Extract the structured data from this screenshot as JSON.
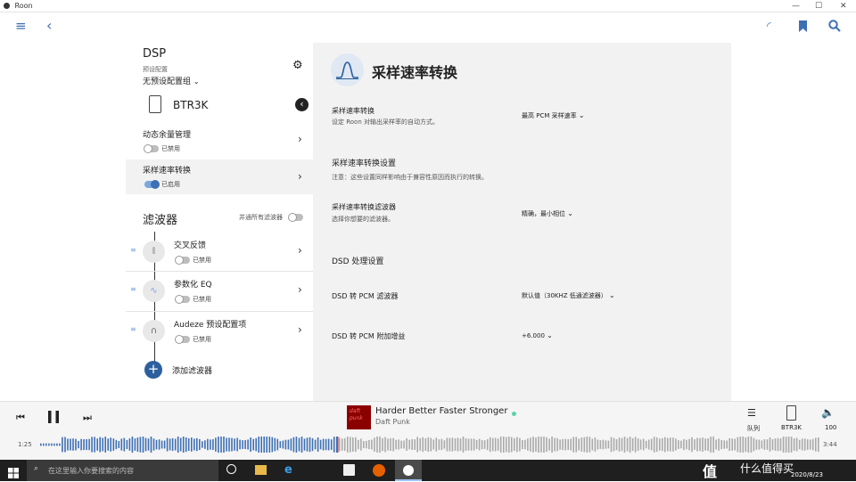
{
  "window": {
    "title": "Roon"
  },
  "left": {
    "dsp_title": "DSP",
    "preset_label": "预设配置",
    "preset_value": "无预设配置组",
    "device_name": "BTR3K",
    "headroom": {
      "label": "动态余量管理",
      "state": "已禁用"
    },
    "resample": {
      "label": "采样速率转换",
      "state": "已启用"
    },
    "filters_title": "滤波器",
    "bypass_label": "并通所有滤波器",
    "filters": [
      {
        "label": "交叉反馈",
        "state": "已禁用"
      },
      {
        "label": "参数化 EQ",
        "state": "已禁用"
      },
      {
        "label": "Audeze 预设配置项",
        "state": "已禁用"
      }
    ],
    "add_filter": "添加滤波器"
  },
  "right": {
    "title": "采样速率转换",
    "row1": {
      "label": "采样速率转换",
      "desc": "设定 Roon 对输出采样率的自动方式。",
      "value": "最高 PCM 采样速率"
    },
    "section2": "采样速率转换设置",
    "section2_note": "注意：这些设置同样影响由于兼容性原因而执行的转换。",
    "row2": {
      "label": "采样速率转换滤波器",
      "desc": "选择你想要的滤波器。",
      "value": "精确，最小相位"
    },
    "section3": "DSD 处理设置",
    "row3": {
      "label": "DSD 转 PCM 滤波器",
      "value": "默认值（30KHZ 低通滤波器）"
    },
    "row4": {
      "label": "DSD 转 PCM 附加增益",
      "value": "+6.000"
    }
  },
  "player": {
    "track_title": "Harder Better Faster Stronger",
    "artist": "Daft Punk",
    "art_text": "daft punk",
    "elapsed": "1:25",
    "total": "3:44",
    "queue_label": "队列",
    "zone_label": "BTR3K",
    "volume": "100",
    "progress": 0.38
  },
  "taskbar": {
    "search_placeholder": "在这里输入你要搜索的内容",
    "time": "",
    "date": "2020/8/23",
    "watermark": "什么值得买"
  },
  "colors": {
    "accent": "#3d6fb3",
    "panel": "#f2f2f2",
    "taskbar": "#1f1f1f",
    "art": "#8b0000"
  }
}
